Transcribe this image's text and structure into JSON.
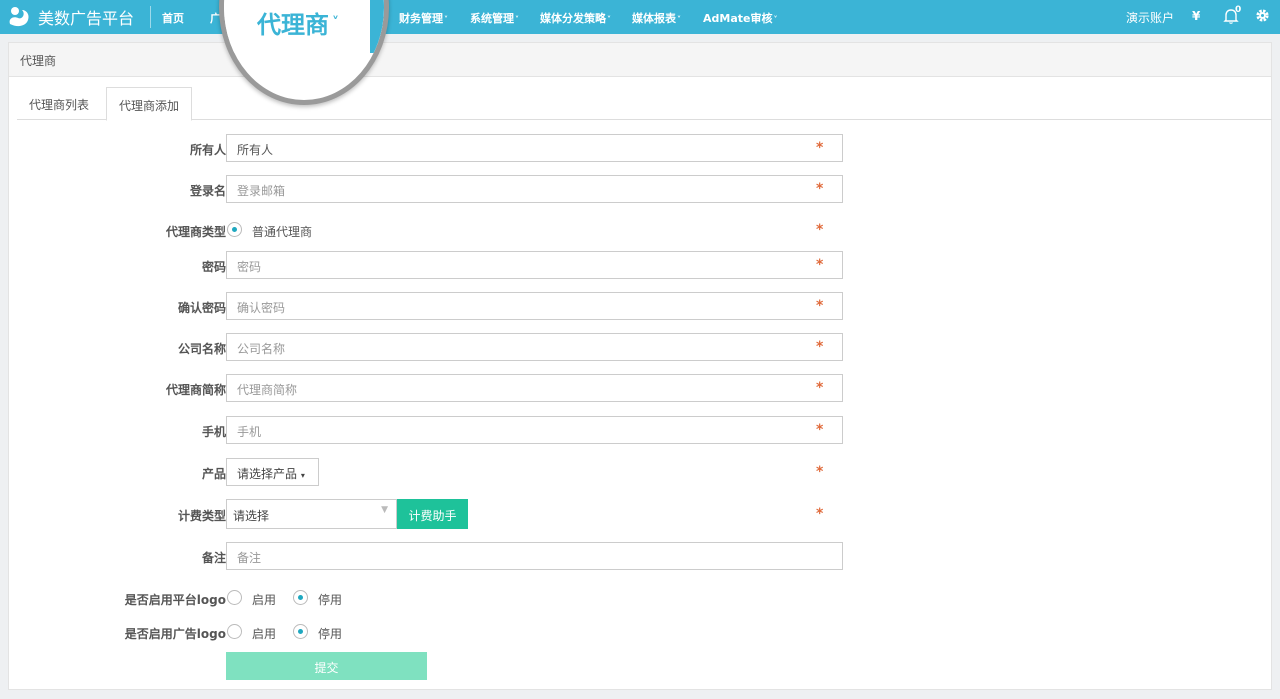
{
  "app": {
    "name": "美数广告平台"
  },
  "nav": [
    {
      "label": "首页",
      "caret": false
    },
    {
      "label": "广",
      "caret": false
    },
    {
      "label": "财务管理",
      "caret": true
    },
    {
      "label": "系统管理",
      "caret": true
    },
    {
      "label": "媒体分发策略",
      "caret": true
    },
    {
      "label": "媒体报表",
      "caret": true
    },
    {
      "label": "AdMate审核",
      "caret": true
    }
  ],
  "magnifier": {
    "label": "代理商"
  },
  "right": {
    "account": "演示账户",
    "currency": "¥",
    "notif_count": "0"
  },
  "breadcrumb": "代理商",
  "tabs": [
    {
      "label": "代理商列表"
    },
    {
      "label": "代理商添加"
    }
  ],
  "form": {
    "owner": {
      "label": "所有人",
      "value": "所有人"
    },
    "login": {
      "label": "登录名",
      "placeholder": "登录邮箱"
    },
    "agent_type": {
      "label": "代理商类型",
      "option": "普通代理商"
    },
    "password": {
      "label": "密码",
      "placeholder": "密码"
    },
    "confirm": {
      "label": "确认密码",
      "placeholder": "确认密码"
    },
    "company": {
      "label": "公司名称",
      "placeholder": "公司名称"
    },
    "short_name": {
      "label": "代理商简称",
      "placeholder": "代理商简称"
    },
    "phone": {
      "label": "手机",
      "placeholder": "手机"
    },
    "product": {
      "label": "产品",
      "button": "请选择产品"
    },
    "billing": {
      "label": "计费类型",
      "select": "请选择",
      "helper": "计费助手"
    },
    "note": {
      "label": "备注",
      "placeholder": "备注"
    },
    "platform_logo": {
      "label": "是否启用平台logo",
      "on": "启用",
      "off": "停用"
    },
    "ad_logo": {
      "label": "是否启用广告logo",
      "on": "启用",
      "off": "停用"
    },
    "submit": "提交",
    "required_mark": "*"
  },
  "colors": {
    "topbar": "#3bb4d6",
    "accent": "#1fa8c0",
    "required": "#e06a3b",
    "helper_button": "#1ec29a",
    "submit_button": "#7fe1c0"
  }
}
